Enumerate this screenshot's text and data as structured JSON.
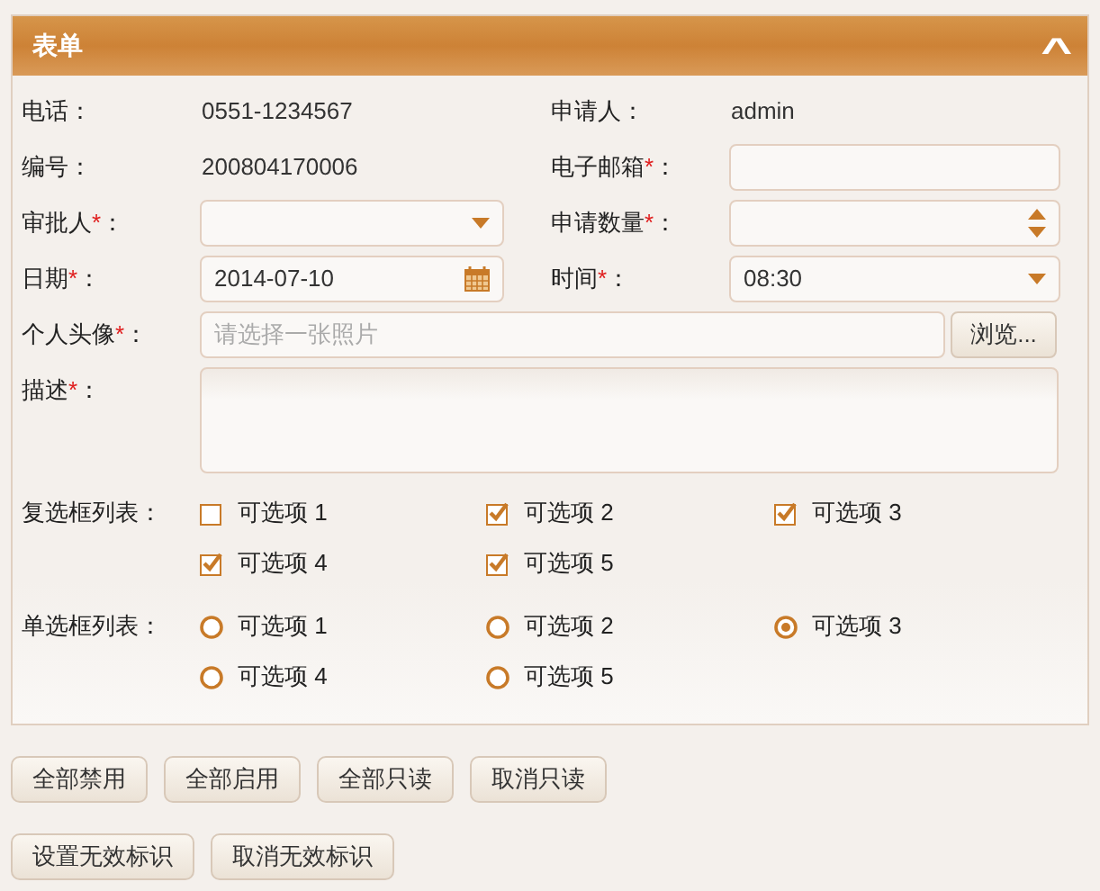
{
  "panel": {
    "title": "表单",
    "collapse_icon": "^"
  },
  "grid_rows": [
    [
      {
        "label": "电话：",
        "kind": "text",
        "value": "0551-1234567"
      },
      {
        "label": "申请人：",
        "kind": "text",
        "value": "admin"
      }
    ],
    [
      {
        "label": "编号：",
        "kind": "text",
        "value": "200804170006"
      },
      {
        "label": "电子邮箱",
        "required_mark": "*",
        "colon": "：",
        "kind": "input"
      }
    ],
    [
      {
        "label": "审批人",
        "required_mark": "*",
        "colon": "：",
        "kind": "select"
      },
      {
        "label": "申请数量",
        "required_mark": "*",
        "colon": "：",
        "kind": "spinner"
      }
    ],
    [
      {
        "label": "日期",
        "required_mark": "*",
        "colon": "：",
        "kind": "date",
        "value": "2014-07-10"
      },
      {
        "label": "时间",
        "required_mark": "*",
        "colon": "：",
        "kind": "select",
        "value": "08:30"
      }
    ]
  ],
  "avatar": {
    "label": "个人头像",
    "required_mark": "*",
    "colon": "：",
    "placeholder": "请选择一张照片",
    "button": "浏览..."
  },
  "description": {
    "label": "描述",
    "required_mark": "*",
    "colon": "："
  },
  "checkbox_list": {
    "label": "复选框列表：",
    "options": [
      {
        "label": "可选项 1",
        "checked": false
      },
      {
        "label": "可选项 2",
        "checked": true
      },
      {
        "label": "可选项 3",
        "checked": true
      },
      {
        "label": "可选项 4",
        "checked": true
      },
      {
        "label": "可选项 5",
        "checked": true
      }
    ]
  },
  "radio_list": {
    "label": "单选框列表：",
    "options": [
      {
        "label": "可选项 1",
        "selected": false
      },
      {
        "label": "可选项 2",
        "selected": false
      },
      {
        "label": "可选项 3",
        "selected": true
      },
      {
        "label": "可选项 4",
        "selected": false
      },
      {
        "label": "可选项 5",
        "selected": false
      }
    ]
  },
  "button_rows": [
    [
      "全部禁用",
      "全部启用",
      "全部只读",
      "取消只读"
    ],
    [
      "设置无效标识",
      "取消无效标识"
    ]
  ]
}
